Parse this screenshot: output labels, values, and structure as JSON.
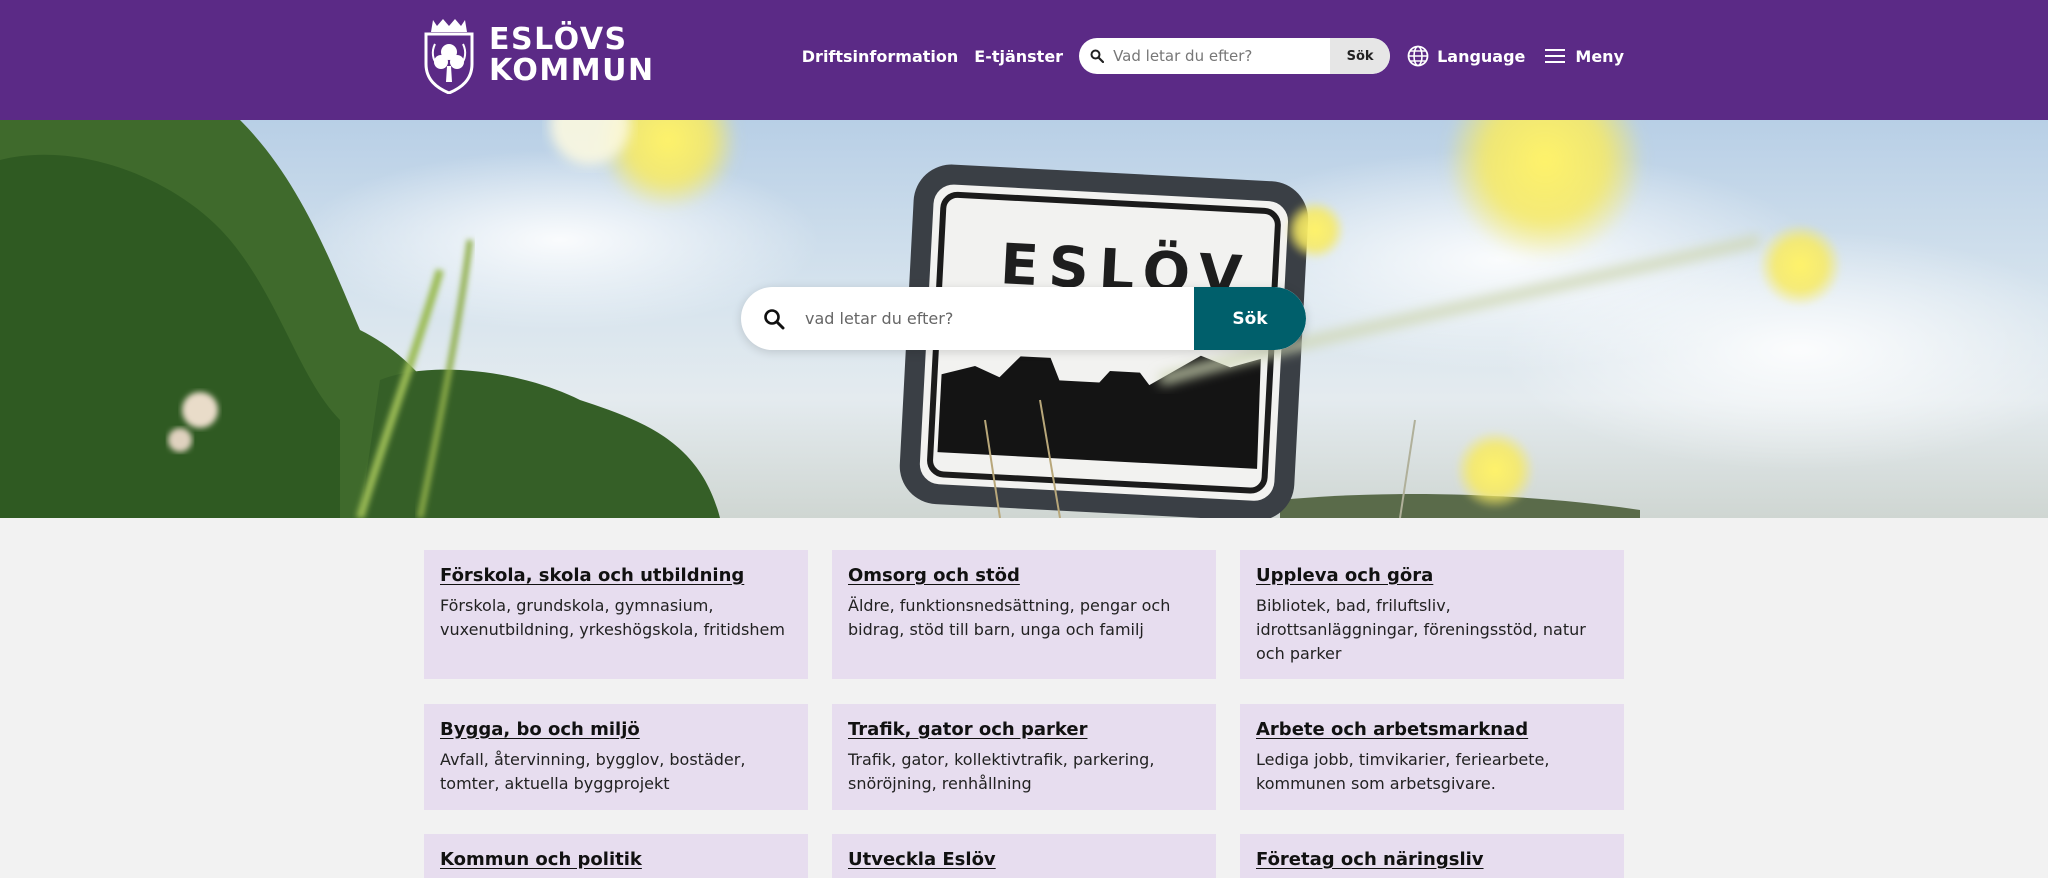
{
  "header": {
    "logo_line1": "ESLÖVS",
    "logo_line2": "KOMMUN",
    "nav": {
      "driftsinformation": "Driftsinformation",
      "etjanster": "E-tjänster"
    },
    "search": {
      "placeholder": "Vad letar du efter?",
      "button": "Sök"
    },
    "language": "Language",
    "menu": "Meny",
    "colors": {
      "background": "#5b2a86"
    }
  },
  "hero": {
    "search": {
      "placeholder": "vad letar du efter?",
      "button": "Sök"
    },
    "sign_text": "ESLÖV",
    "colors": {
      "button": "#005f6b"
    }
  },
  "cards": [
    {
      "title": "Förskola, skola och utbildning",
      "desc": "Förskola, grundskola, gymnasium, vuxenutbildning, yrkeshögskola, fritidshem"
    },
    {
      "title": "Omsorg och stöd",
      "desc": "Äldre, funktionsnedsättning, pengar och bidrag, stöd till barn, unga och familj"
    },
    {
      "title": "Uppleva och göra",
      "desc": "Bibliotek, bad, friluftsliv, idrottsanläggningar, föreningsstöd, natur och parker"
    },
    {
      "title": "Bygga, bo och miljö",
      "desc": "Avfall, återvinning, bygglov, bostäder, tomter, aktuella byggprojekt"
    },
    {
      "title": "Trafik, gator och parker",
      "desc": "Trafik, gator, kollektivtrafik, parkering, snöröjning, renhållning"
    },
    {
      "title": "Arbete och arbetsmarknad",
      "desc": "Lediga jobb, timvikarier, feriearbete, kommunen som arbetsgivare."
    },
    {
      "title": "Kommun och politik",
      "desc": ""
    },
    {
      "title": "Utveckla Eslöv",
      "desc": ""
    },
    {
      "title": "Företag och näringsliv",
      "desc": ""
    }
  ],
  "icons": {
    "crest": "crest-logo-icon",
    "search": "search-icon",
    "globe": "globe-icon",
    "menu": "hamburger-menu-icon"
  }
}
